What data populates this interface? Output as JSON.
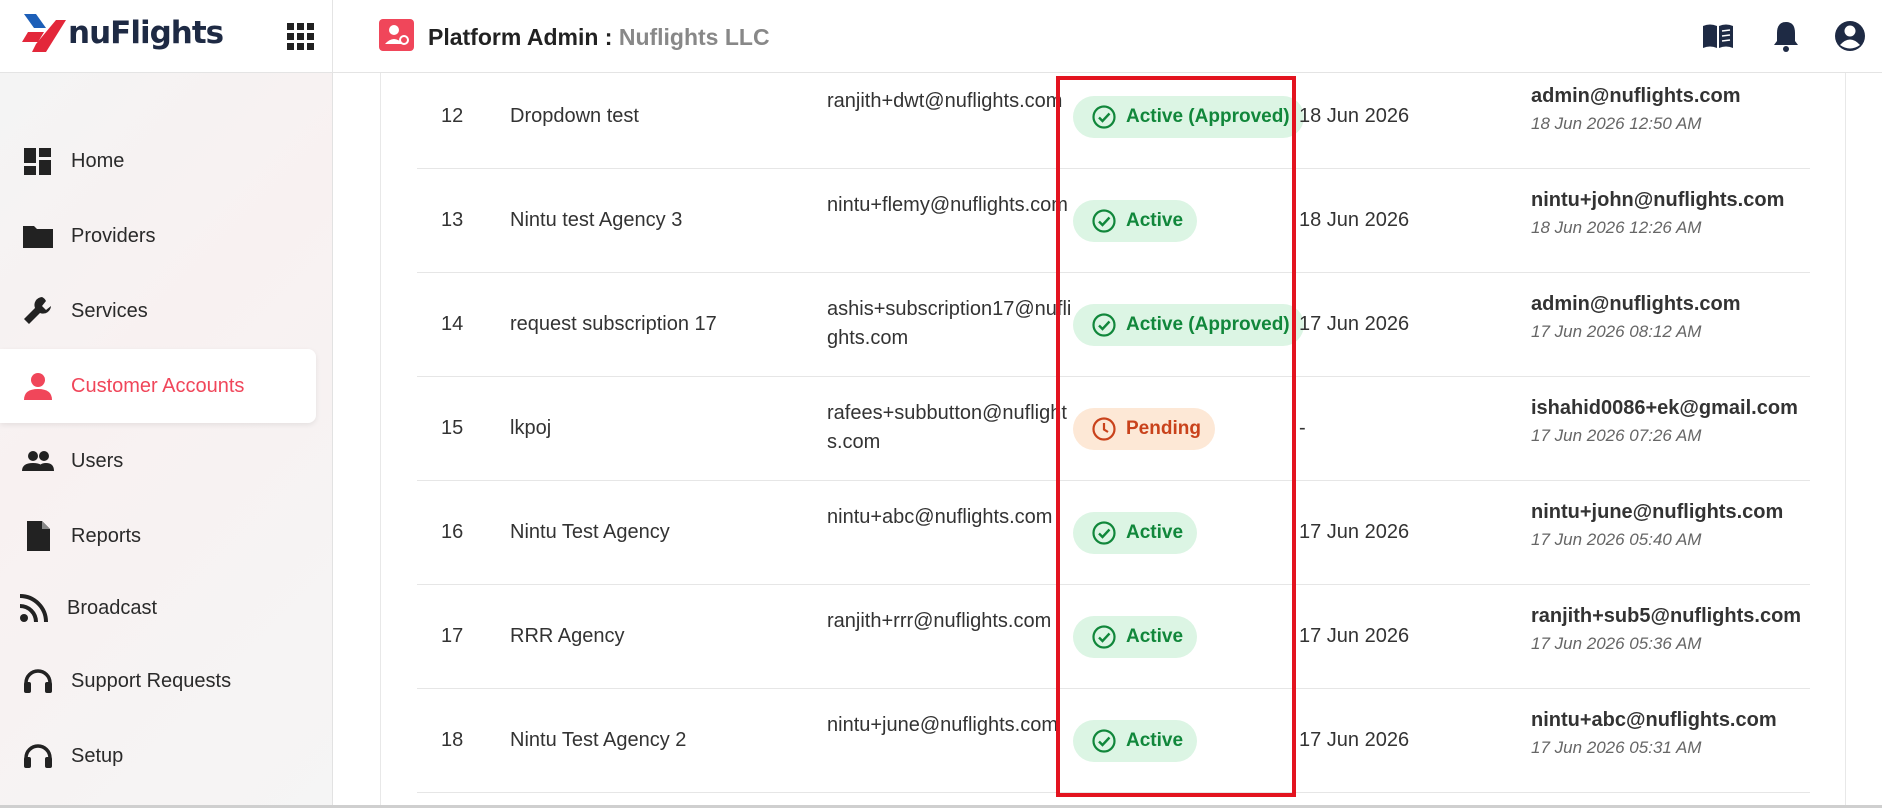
{
  "header": {
    "brand": "nuFlights",
    "title": "Platform Admin :",
    "organization": "Nuflights LLC"
  },
  "sidebar": {
    "items": [
      {
        "label": "Home",
        "icon": "dashboard-icon"
      },
      {
        "label": "Providers",
        "icon": "folder-icon"
      },
      {
        "label": "Services",
        "icon": "wrench-icon"
      },
      {
        "label": "Customer Accounts",
        "icon": "person-icon",
        "active": true
      },
      {
        "label": "Users",
        "icon": "people-icon"
      },
      {
        "label": "Reports",
        "icon": "document-icon"
      },
      {
        "label": "Broadcast",
        "icon": "rss-icon"
      },
      {
        "label": "Support Requests",
        "icon": "headset-icon"
      },
      {
        "label": "Setup",
        "icon": "headset-icon"
      }
    ]
  },
  "colors": {
    "accent": "#f0465a",
    "active_green": "#11873b",
    "active_bg": "#dcf5e4",
    "pending_orange": "#c9421b",
    "pending_bg": "#fde8d6",
    "highlight_red": "#e3131f"
  },
  "table": {
    "rows": [
      {
        "num": "12",
        "name": "Dropdown test",
        "email": "ranjith+dwt@nuflights.com",
        "status": "Active (Approved)",
        "status_type": "active",
        "date": "18 Jun 2026",
        "by_email": "admin@nuflights.com",
        "by_time": "18 Jun 2026 12:50 AM"
      },
      {
        "num": "13",
        "name": "Nintu test Agency 3",
        "email": "nintu+flemy@nuflights.com",
        "status": "Active",
        "status_type": "active",
        "date": "18 Jun 2026",
        "by_email": "nintu+john@nuflights.com",
        "by_time": "18 Jun 2026 12:26 AM"
      },
      {
        "num": "14",
        "name": "request subscription 17",
        "email": "ashis+subscription17@nuflights.com",
        "status": "Active (Approved)",
        "status_type": "active",
        "date": "17 Jun 2026",
        "by_email": "admin@nuflights.com",
        "by_time": "17 Jun 2026 08:12 AM"
      },
      {
        "num": "15",
        "name": "lkpoj",
        "email": "rafees+subbutton@nuflights.com",
        "status": "Pending",
        "status_type": "pending",
        "date": "-",
        "by_email": "ishahid0086+ek@gmail.com",
        "by_time": "17 Jun 2026 07:26 AM"
      },
      {
        "num": "16",
        "name": "Nintu Test Agency",
        "email": "nintu+abc@nuflights.com",
        "status": "Active",
        "status_type": "active",
        "date": "17 Jun 2026",
        "by_email": "nintu+june@nuflights.com",
        "by_time": "17 Jun 2026 05:40 AM"
      },
      {
        "num": "17",
        "name": "RRR Agency",
        "email": "ranjith+rrr@nuflights.com",
        "status": "Active",
        "status_type": "active",
        "date": "17 Jun 2026",
        "by_email": "ranjith+sub5@nuflights.com",
        "by_time": "17 Jun 2026 05:36 AM"
      },
      {
        "num": "18",
        "name": "Nintu Test Agency 2",
        "email": "nintu+june@nuflights.com",
        "status": "Active",
        "status_type": "active",
        "date": "17 Jun 2026",
        "by_email": "nintu+abc@nuflights.com",
        "by_time": "17 Jun 2026 05:31 AM"
      }
    ]
  }
}
